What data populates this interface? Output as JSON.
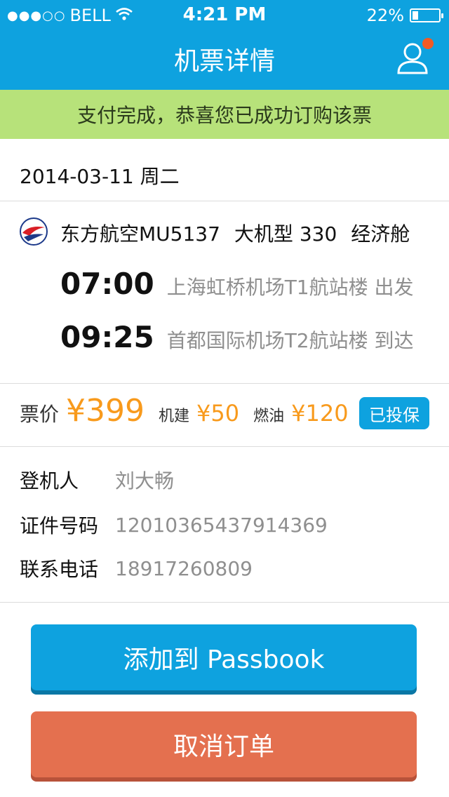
{
  "status_bar": {
    "carrier": "BELL",
    "time": "4:21 PM",
    "battery_text": "22%",
    "battery_level": 0.22
  },
  "header": {
    "title": "机票详情",
    "user_icon": "user-icon",
    "notification_color": "#f15a24"
  },
  "banner": {
    "text": "支付完成，恭喜您已成功订购该票"
  },
  "trip": {
    "date": "2014-03-11 周二",
    "airline": "东方航空MU5137",
    "aircraft": "大机型 330",
    "cabin": "经济舱",
    "departure": {
      "time": "07:00",
      "place": "上海虹桥机场T1航站楼 出发"
    },
    "arrival": {
      "time": "09:25",
      "place": "首都国际机场T2航站楼 到达"
    }
  },
  "price": {
    "label": "票价",
    "value": "¥399",
    "airport_fee_label": "机建",
    "airport_fee": "¥50",
    "fuel_label": "燃油",
    "fuel": "¥120",
    "insured_label": "已投保"
  },
  "passenger": {
    "name_label": "登机人",
    "name": "刘大畅",
    "id_label": "证件号码",
    "id": "12010365437914369",
    "phone_label": "联系电话",
    "phone": "18917260809"
  },
  "actions": {
    "passbook_label": "添加到 Passbook",
    "cancel_label": "取消订单"
  },
  "colors": {
    "primary": "#0ea2df",
    "banner": "#b7e27a",
    "price": "#f89a1c",
    "cancel": "#e4704f"
  }
}
